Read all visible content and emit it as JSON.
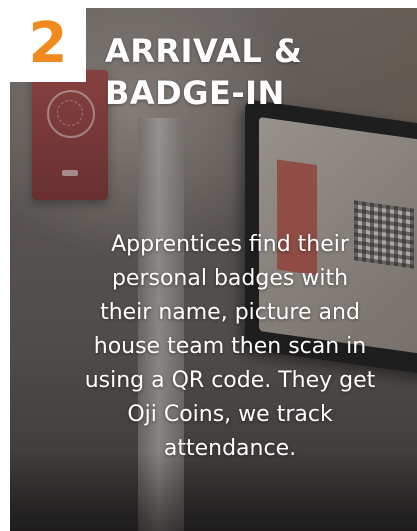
{
  "card": {
    "step_number": "2",
    "title_lines": [
      "ARRIVAL &",
      "BADGE-IN"
    ],
    "description_lines": [
      "Apprentices find their",
      "personal badges with",
      "their name, picture and",
      "house team then scan in",
      "using a QR code. They get",
      "Oji Coins, we track",
      "attendance."
    ]
  },
  "colors": {
    "accent": "#f08a1c",
    "text": "#ffffff",
    "badge_background": "#ffffff"
  }
}
